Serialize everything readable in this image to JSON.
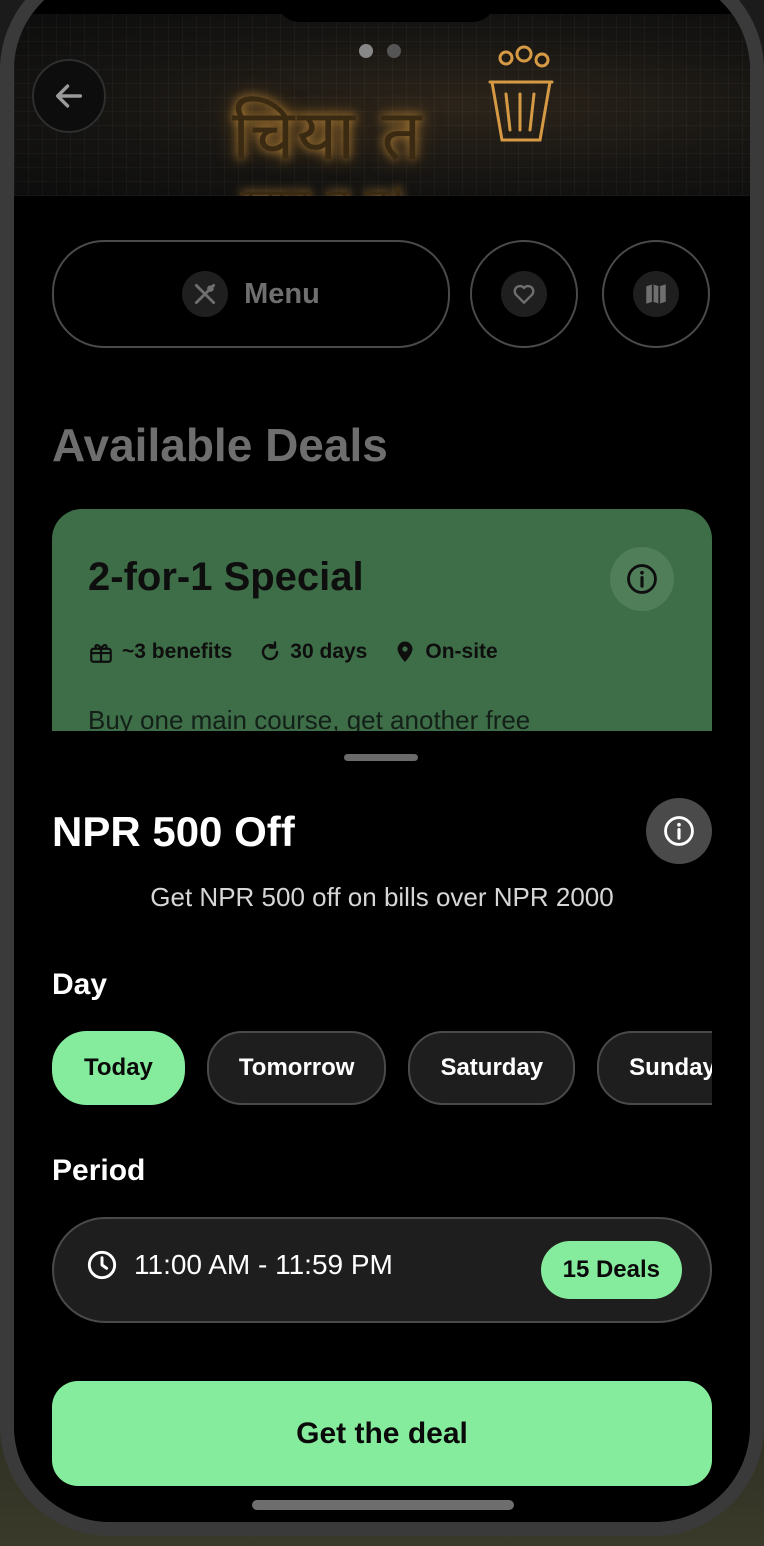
{
  "hero": {
    "sign_line1": "चिया त",
    "sign_line2": "खाउ न त!",
    "carousel_dots": 2
  },
  "actions": {
    "menu_label": "Menu"
  },
  "available_deals": {
    "title": "Available Deals",
    "card": {
      "title": "2-for-1 Special",
      "benefits": "~3 benefits",
      "duration": "30 days",
      "location": "On-site",
      "description": "Buy one main course, get another free",
      "color": "#3e6e48"
    }
  },
  "sheet": {
    "title": "NPR 500 Off",
    "description": "Get NPR 500 off on bills over NPR 2000",
    "day_label": "Day",
    "days": [
      {
        "label": "Today",
        "selected": true
      },
      {
        "label": "Tomorrow",
        "selected": false
      },
      {
        "label": "Saturday",
        "selected": false
      },
      {
        "label": "Sunday",
        "selected": false
      }
    ],
    "period_label": "Period",
    "period": {
      "time": "11:00 AM - 11:59 PM",
      "deals_badge": "15 Deals"
    },
    "cta_label": "Get the deal",
    "accent": "#86ec9d"
  },
  "icons": [
    "back-arrow-icon",
    "utensils-icon",
    "heart-icon",
    "map-icon",
    "info-icon",
    "gift-icon",
    "refresh-icon",
    "location-pin-icon",
    "clock-icon"
  ]
}
